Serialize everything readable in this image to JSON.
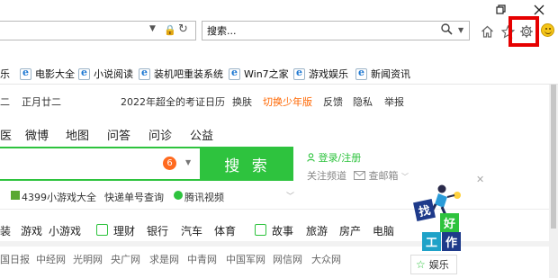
{
  "window": {
    "restore_icon": "restore-icon",
    "close_icon": "close-icon"
  },
  "address": {
    "search_value": "搜索..."
  },
  "favorites": [
    {
      "label": "乐"
    },
    {
      "label": "电影大全"
    },
    {
      "label": "小说阅读"
    },
    {
      "label": "装机吧重装系统"
    },
    {
      "label": "Win7之家"
    },
    {
      "label": "游戏娱乐"
    },
    {
      "label": "新闻资讯"
    }
  ],
  "header_row": {
    "date_partial": "二",
    "lunar": "正月廿二",
    "promo_link": "2022年超全的考证日历",
    "skin": "换肤",
    "young_mode": "切换少年版",
    "feedback": "反馈",
    "privacy": "隐私",
    "report": "举报"
  },
  "nav": [
    "医",
    "微博",
    "地图",
    "问答",
    "问诊",
    "公益"
  ],
  "search": {
    "badge": "6",
    "button": "搜 索"
  },
  "account": {
    "login": "登录/注册",
    "follow": "关注频道",
    "mail": "查邮箱"
  },
  "quick_links": [
    "4399小游戏大全",
    "快递单号查询",
    "腾讯视频"
  ],
  "categories": [
    "装",
    "游戏",
    "小游戏",
    "理财",
    "银行",
    "汽车",
    "体育",
    "故事",
    "旅游",
    "房产",
    "电脑"
  ],
  "site_links": [
    "国日报",
    "中经网",
    "光明网",
    "央广网",
    "求是网",
    "中青网",
    "中国军网",
    "网信网",
    "大众网"
  ],
  "promo": {
    "tiles": [
      "找",
      "好",
      "工",
      "作"
    ],
    "entertainment": "娱乐"
  },
  "colors": {
    "accent_green": "#2ec33e",
    "highlight_red": "#e60000",
    "orange": "#ff6600"
  }
}
